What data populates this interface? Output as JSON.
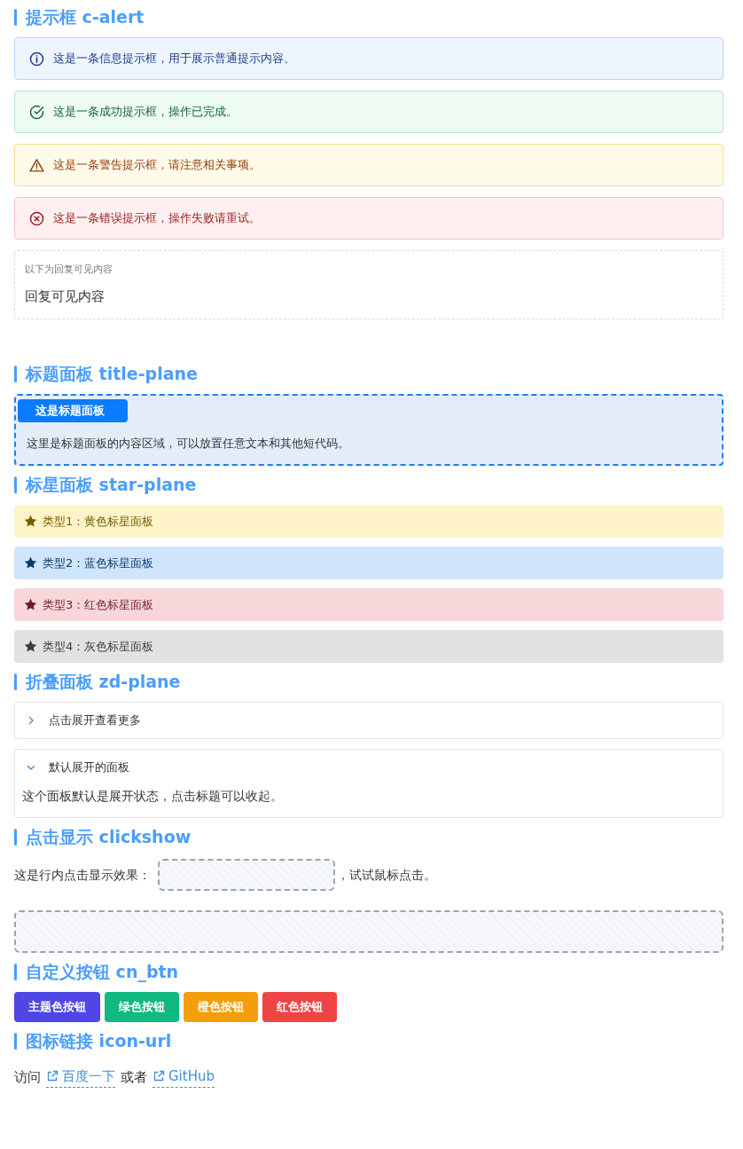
{
  "sections": [
    {
      "kind": "alerts",
      "title": "提示框 c-alert",
      "alerts": [
        {
          "kind": "info",
          "text": "这是一条信息提示框，用于展示普通提示内容。"
        },
        {
          "kind": "success",
          "text": "这是一条成功提示框，操作已完成。"
        },
        {
          "kind": "warning",
          "text": "这是一条警告提示框，请注意相关事项。"
        },
        {
          "kind": "error",
          "text": "这是一条错误提示框，操作失败请重试。"
        }
      ],
      "reply": {
        "label": "以下为回复可见内容",
        "text": "回复可见内容"
      }
    },
    {
      "kind": "title_panel",
      "title": "标题面板 title-plane",
      "label": "这是标题面板",
      "text": "这里是标题面板的内容区域，可以放置任意文本和其他短代码。"
    },
    {
      "kind": "star_panels",
      "title": "标星面板 star-plane",
      "panels": [
        {
          "kind": "yellow",
          "text": "类型1：黄色标星面板"
        },
        {
          "kind": "blue",
          "text": "类型2：蓝色标星面板"
        },
        {
          "kind": "red",
          "text": "类型3：红色标星面板"
        },
        {
          "kind": "gray",
          "text": "类型4：灰色标星面板"
        }
      ]
    },
    {
      "kind": "collapse",
      "title": "折叠面板 zd-plane",
      "panels": [
        {
          "title": "点击展开查看更多",
          "expanded": false
        },
        {
          "title": "默认展开的面板",
          "expanded": true,
          "body": "这个面板默认是展开状态，点击标题可以收起。"
        }
      ]
    },
    {
      "kind": "clickshow",
      "title": "点击显示 clickshow",
      "before": "这是行内点击显示效果：",
      "after": "，试试鼠标点击。"
    },
    {
      "kind": "buttons",
      "title": "自定义按钮 cn_btn",
      "buttons": [
        {
          "kind": "primary",
          "label": "主题色按钮"
        },
        {
          "kind": "green",
          "label": "绿色按钮"
        },
        {
          "kind": "orange",
          "label": "橙色按钮"
        },
        {
          "kind": "red",
          "label": "红色按钮"
        }
      ]
    },
    {
      "kind": "links",
      "title": "图标链接 icon-url",
      "prefix": "访问",
      "links": [
        "百度一下",
        "GitHub"
      ],
      "between": "或者"
    }
  ]
}
